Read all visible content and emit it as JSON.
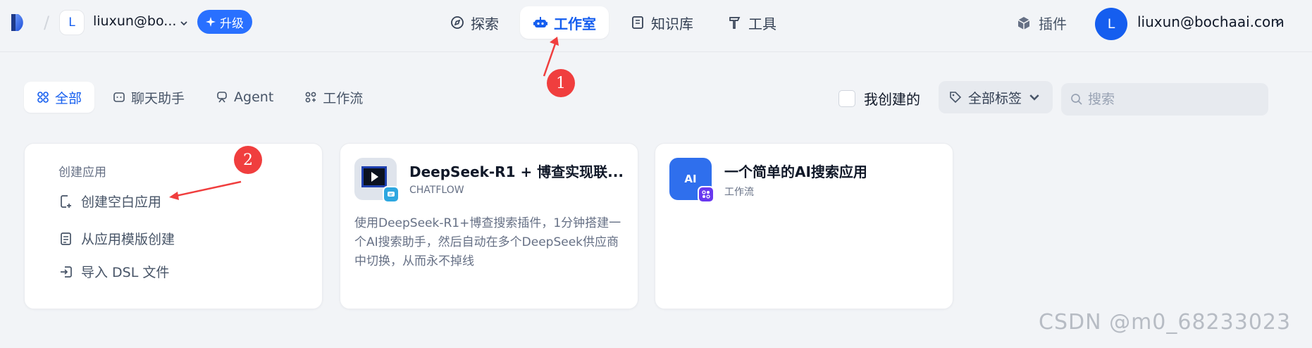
{
  "header": {
    "workspace": {
      "avatar_letter": "L",
      "name": "liuxun@bo..."
    },
    "upgrade_label": "升级",
    "nav": [
      {
        "label": "探索",
        "icon": "compass-icon",
        "active": false
      },
      {
        "label": "工作室",
        "icon": "robot-icon",
        "active": true
      },
      {
        "label": "知识库",
        "icon": "book-icon",
        "active": false
      },
      {
        "label": "工具",
        "icon": "hammer-icon",
        "active": false
      }
    ],
    "plugin_label": "插件",
    "user": {
      "avatar_letter": "L",
      "email": "liuxun@bochaai.com"
    }
  },
  "filters": {
    "tabs": [
      {
        "label": "全部",
        "icon": "grid-icon",
        "active": true
      },
      {
        "label": "聊天助手",
        "icon": "chat-icon",
        "active": false
      },
      {
        "label": "Agent",
        "icon": "agent-icon",
        "active": false
      },
      {
        "label": "工作流",
        "icon": "workflow-icon",
        "active": false
      }
    ],
    "mine_label": "我创建的",
    "mine_checked": false,
    "tag_filter_label": "全部标签",
    "search_placeholder": "搜索"
  },
  "create_card": {
    "title": "创建应用",
    "items": [
      {
        "label": "创建空白应用",
        "icon": "file-plus-icon"
      },
      {
        "label": "从应用模版创建",
        "icon": "template-icon"
      },
      {
        "label": "导入 DSL 文件",
        "icon": "import-icon"
      }
    ]
  },
  "apps": [
    {
      "name": "DeepSeek-R1 + 博查实现联...",
      "type": "CHATFLOW",
      "description": "使用DeepSeek-R1+博查搜索插件，1分钟搭建一个AI搜索助手，然后自动在多个DeepSeek供应商中切换，从而永不掉线"
    },
    {
      "name": "一个简单的AI搜索应用",
      "type": "工作流",
      "icon_text": "AI",
      "description": ""
    }
  ],
  "annotations": {
    "marker_1": "1",
    "marker_2": "2"
  },
  "watermark": "CSDN @m0_68233023",
  "colors": {
    "accent": "#155eef",
    "annotation": "#f03e3e",
    "background": "#f2f4f7"
  }
}
